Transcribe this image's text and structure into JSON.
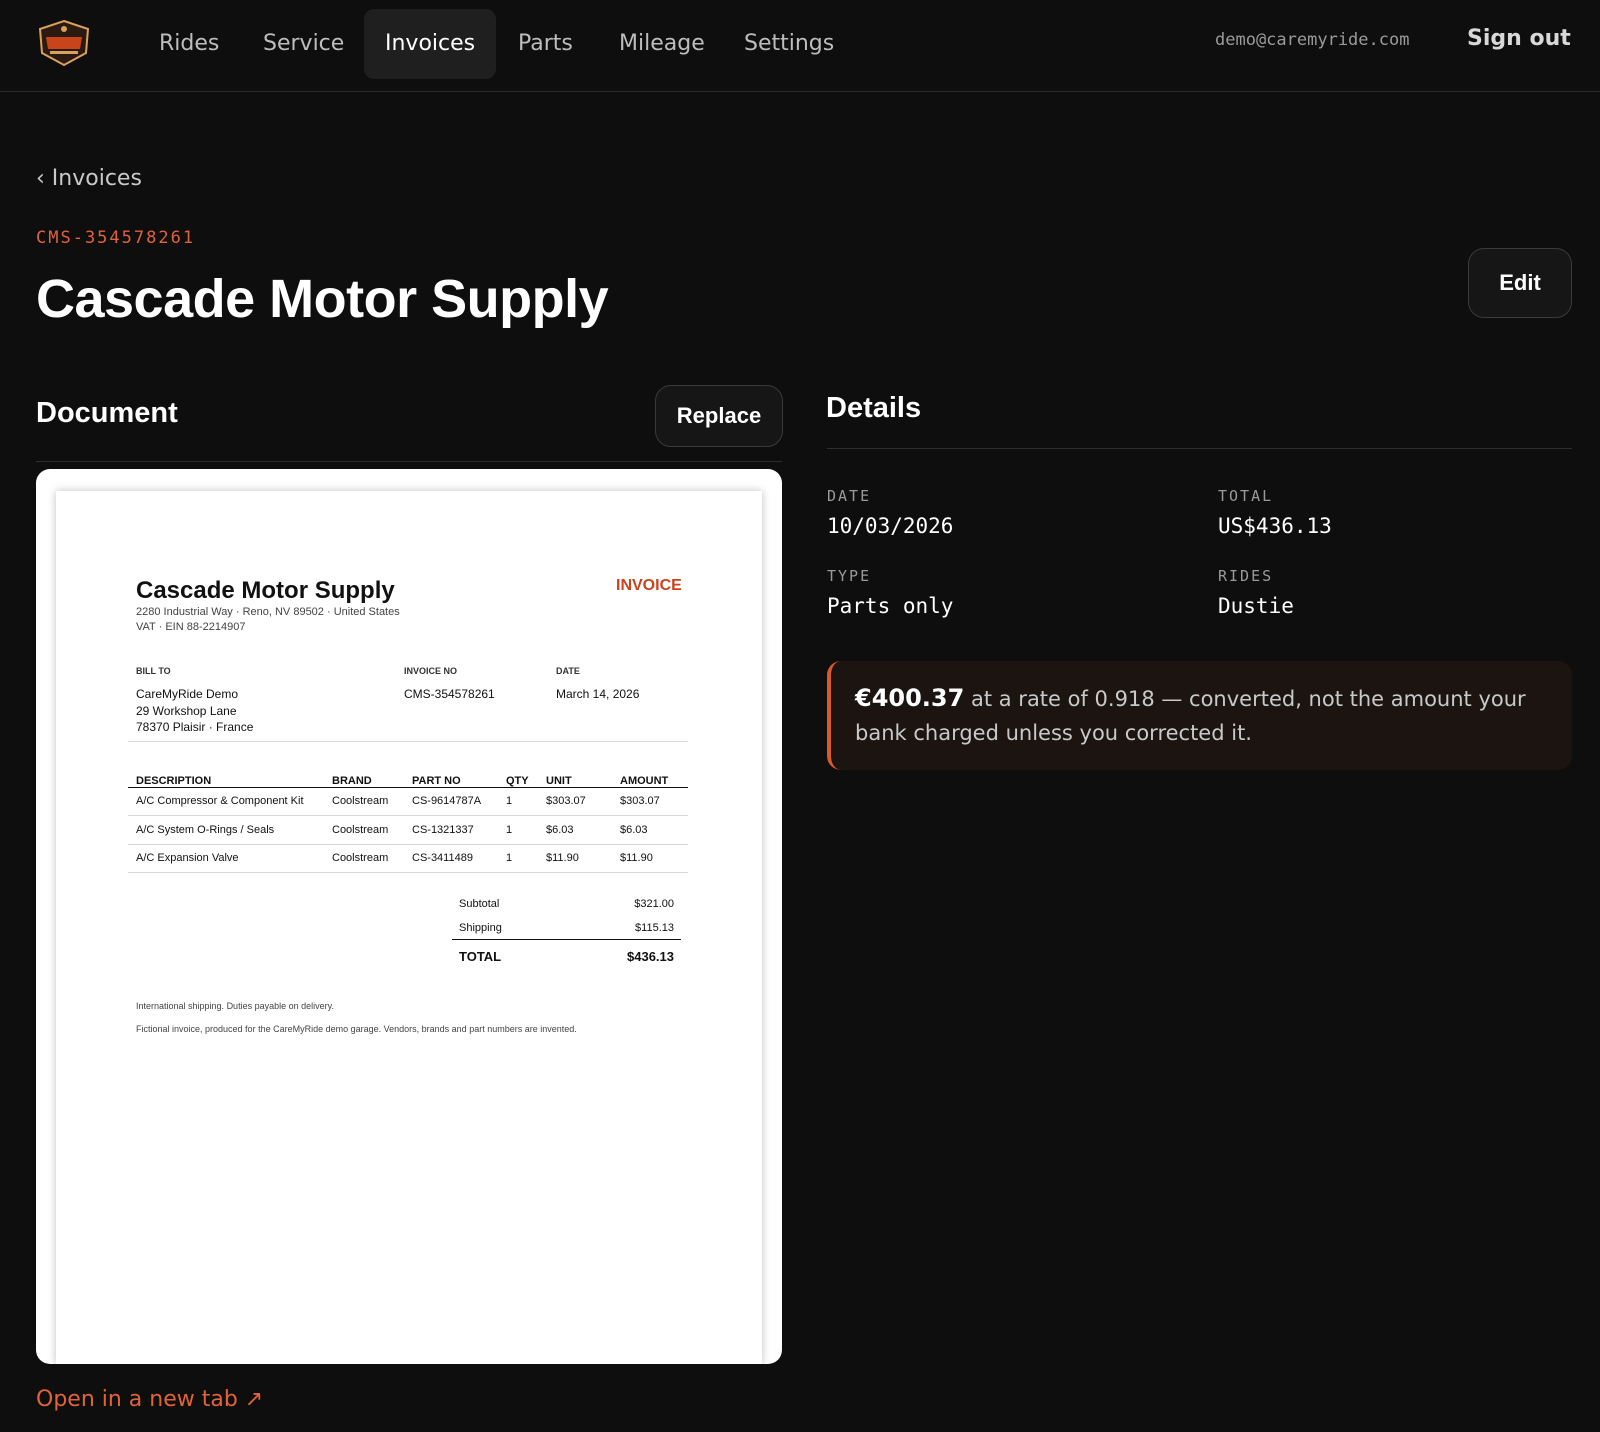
{
  "nav": {
    "items": [
      {
        "label": "Rides"
      },
      {
        "label": "Service"
      },
      {
        "label": "Invoices"
      },
      {
        "label": "Parts"
      },
      {
        "label": "Mileage"
      },
      {
        "label": "Settings"
      }
    ],
    "active": "Invoices",
    "user_email": "demo@caremyride.com",
    "signout_label": "Sign out"
  },
  "header": {
    "breadcrumb": "‹ Invoices",
    "invoice_ref": "CMS-354578261",
    "title": "Cascade Motor Supply",
    "edit_label": "Edit"
  },
  "document": {
    "heading": "Document",
    "replace_label": "Replace",
    "open_link": "Open in a new tab ↗",
    "invoice": {
      "vendor": "Cascade Motor Supply",
      "vendor_address": "2280 Industrial Way · Reno, NV 89502 · United States",
      "vendor_tax": "VAT · EIN 88-2214907",
      "doc_type": "INVOICE",
      "bill_to_label": "BILL TO",
      "bill_to_lines": [
        "CareMyRide Demo",
        "29 Workshop Lane",
        "78370 Plaisir · France"
      ],
      "invoice_no_label": "INVOICE NO",
      "invoice_no": "CMS-354578261",
      "date_label": "DATE",
      "date": "March 14, 2026",
      "columns": [
        "DESCRIPTION",
        "BRAND",
        "PART NO",
        "QTY",
        "UNIT",
        "AMOUNT"
      ],
      "rows": [
        [
          "A/C Compressor & Component Kit",
          "Coolstream",
          "CS-9614787A",
          "1",
          "$303.07",
          "$303.07"
        ],
        [
          "A/C System O-Rings / Seals",
          "Coolstream",
          "CS-1321337",
          "1",
          "$6.03",
          "$6.03"
        ],
        [
          "A/C Expansion Valve",
          "Coolstream",
          "CS-3411489",
          "1",
          "$11.90",
          "$11.90"
        ]
      ],
      "subtotal_label": "Subtotal",
      "subtotal": "$321.00",
      "shipping_label": "Shipping",
      "shipping": "$115.13",
      "total_label": "TOTAL",
      "total": "$436.13",
      "footnote_1": "International shipping. Duties payable on delivery.",
      "footnote_2": "Fictional invoice, produced for the CareMyRide demo garage. Vendors, brands and part numbers are invented."
    }
  },
  "details": {
    "heading": "Details",
    "date_label": "DATE",
    "date": "10/03/2026",
    "total_label": "TOTAL",
    "total": "US$436.13",
    "type_label": "TYPE",
    "type": "Parts only",
    "rides_label": "RIDES",
    "rides": "Dustie",
    "conversion_amount": "€400.37",
    "conversion_text": " at a rate of 0.918 — converted, not the amount your bank charged unless you corrected it."
  },
  "colors": {
    "accent": "#e0633a",
    "background": "#0e0e0e",
    "invoice_red": "#c9441b"
  }
}
